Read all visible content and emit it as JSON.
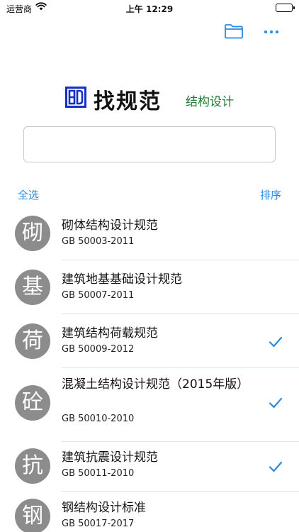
{
  "status_bar": {
    "carrier": "运营商",
    "time": "上午 12:29"
  },
  "brand": {
    "title": "找规范",
    "subtitle": "结构设计"
  },
  "search": {
    "value": "",
    "placeholder": ""
  },
  "list_controls": {
    "select_all": "全选",
    "sort": "排序"
  },
  "items": [
    {
      "glyph": "砌",
      "name": "砌体结构设计规范",
      "code": "GB 50003-2011",
      "checked": false
    },
    {
      "glyph": "基",
      "name": "建筑地基基础设计规范",
      "code": "GB 50007-2011",
      "checked": false
    },
    {
      "glyph": "荷",
      "name": "建筑结构荷载规范",
      "code": "GB 50009-2012",
      "checked": true
    },
    {
      "glyph": "砼",
      "name": "混凝土结构设计规范（2015年版）",
      "code": "GB 50010-2010",
      "checked": true
    },
    {
      "glyph": "抗",
      "name": "建筑抗震设计规范",
      "code": "GB 50011-2010",
      "checked": true
    },
    {
      "glyph": "钢",
      "name": "钢结构设计标准",
      "code": "GB 50017-2017",
      "checked": false
    }
  ],
  "colors": {
    "accent": "#2a8adf",
    "subtitle_green": "#1e7b34",
    "avatar_gray": "#8c8c8c",
    "logo_blue": "#1530c8"
  },
  "icons": {
    "wifi": "wifi-icon",
    "battery": "battery-icon",
    "folder": "folder-icon",
    "more": "ellipsis-icon",
    "logo": "brand-logo",
    "check": "checkmark-icon"
  }
}
